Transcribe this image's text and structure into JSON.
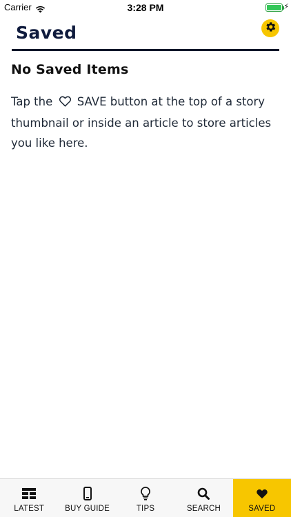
{
  "status_bar": {
    "carrier": "Carrier",
    "time": "3:28 PM",
    "battery_level_percent": 100,
    "icons": [
      "wifi-icon",
      "battery-icon",
      "charging-bolt-icon"
    ]
  },
  "header": {
    "title": "Saved",
    "settings_icon": "gear-icon"
  },
  "empty_state": {
    "title": "No Saved Items",
    "message_before": "Tap the",
    "message_highlight": "SAVE",
    "message_after": "button at the top of a story thumbnail or inside an article to store articles you like here.",
    "inline_icon": "heart-outline-icon"
  },
  "tab_bar": {
    "tabs": [
      {
        "label": "LATEST",
        "icon": "list-icon",
        "active": false
      },
      {
        "label": "BUY GUIDE",
        "icon": "phone-icon",
        "active": false
      },
      {
        "label": "TIPS",
        "icon": "lightbulb-icon",
        "active": false
      },
      {
        "label": "SEARCH",
        "icon": "search-icon",
        "active": false
      },
      {
        "label": "SAVED",
        "icon": "heart-icon",
        "active": true
      }
    ]
  },
  "colors": {
    "accent": "#f7c600",
    "title": "#0f1b3d",
    "battery": "#34c759"
  }
}
